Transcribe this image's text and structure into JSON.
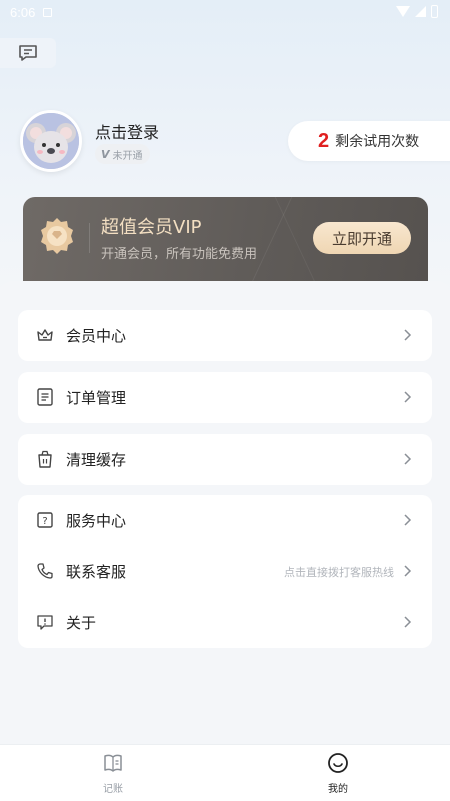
{
  "status_bar": {
    "time": "6:06"
  },
  "profile": {
    "login_text": "点击登录",
    "vip_badge_v": "V",
    "vip_badge_text": "未开通"
  },
  "trial": {
    "count": "2",
    "label": "剩余试用次数"
  },
  "vip_card": {
    "title": "超值会员VIP",
    "subtitle": "开通会员，所有功能免费用",
    "button": "立即开通"
  },
  "menu_groups": {
    "member_center": {
      "label": "会员中心",
      "icon": "crown-icon"
    },
    "order_management": {
      "label": "订单管理",
      "icon": "document-icon"
    },
    "clear_cache": {
      "label": "清理缓存",
      "icon": "trash-icon"
    },
    "service_center": {
      "label": "服务中心",
      "icon": "help-icon"
    },
    "contact_service": {
      "label": "联系客服",
      "hint": "点击直接拨打客服热线",
      "icon": "phone-icon"
    },
    "about": {
      "label": "关于",
      "icon": "info-icon"
    }
  },
  "bottom_nav": {
    "items": [
      {
        "label": "记账",
        "icon": "ledger-icon",
        "active": false
      },
      {
        "label": "我的",
        "icon": "smiley-icon",
        "active": true
      }
    ]
  },
  "colors": {
    "accent_red": "#e02020",
    "vip_gold": "#f3dfc2",
    "vip_card_bg": "#5f5b58",
    "nav_active": "#222222",
    "nav_inactive": "#9aa0a8"
  }
}
